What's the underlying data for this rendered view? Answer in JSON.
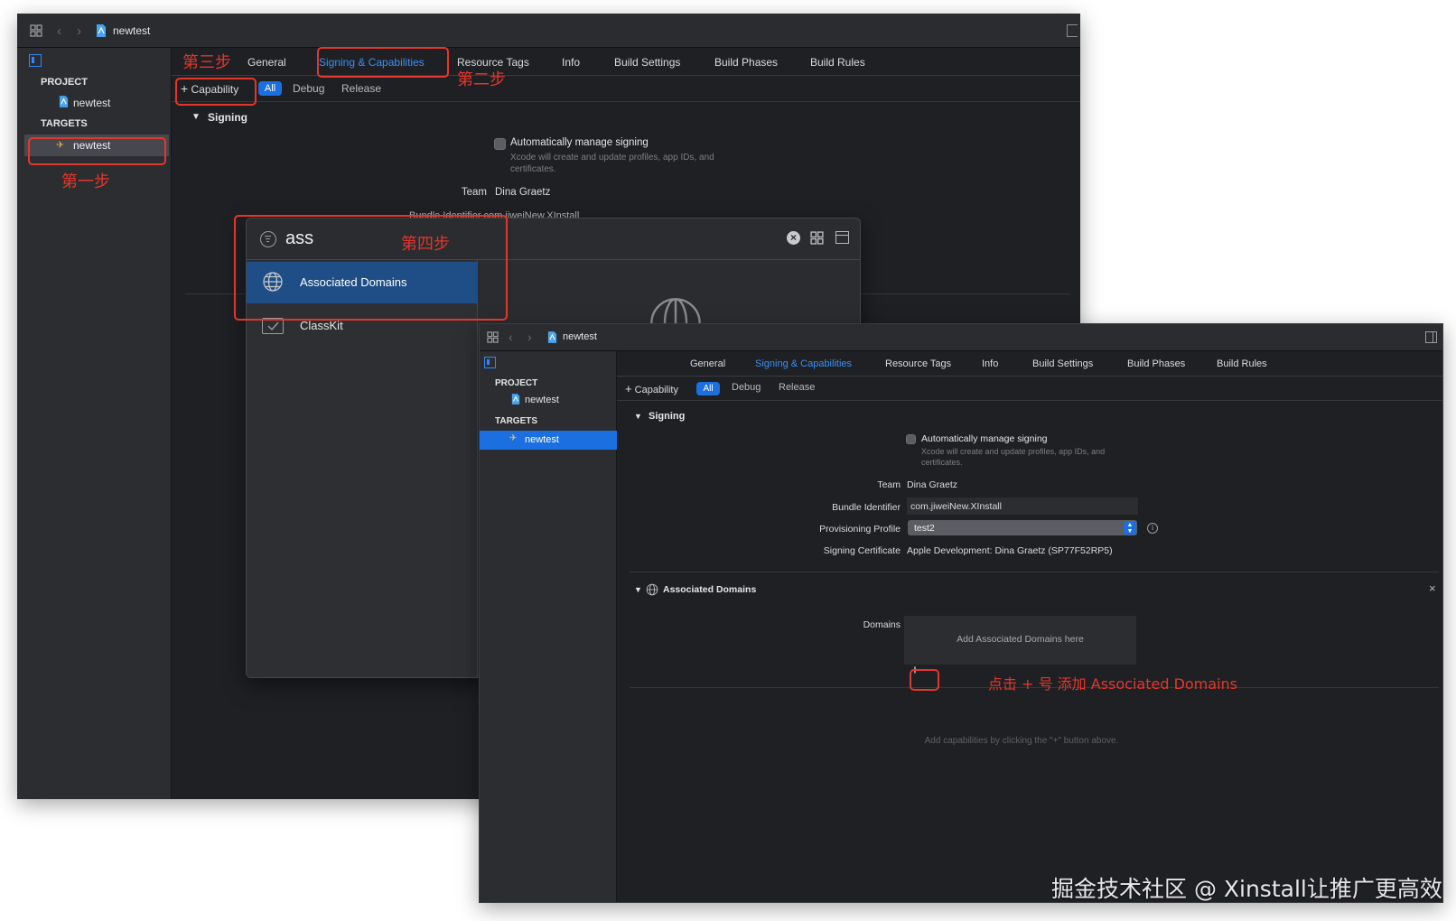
{
  "back_window": {
    "title": "newtest",
    "tabs": [
      "General",
      "Signing & Capabilities",
      "Resource Tags",
      "Info",
      "Build Settings",
      "Build Phases",
      "Build Rules"
    ],
    "active_tab": "Signing & Capabilities",
    "capability_button": "Capability",
    "filters": [
      "All",
      "Debug",
      "Release"
    ],
    "sidebar": {
      "project_header": "PROJECT",
      "project_item": "newtest",
      "targets_header": "TARGETS",
      "target_item": "newtest"
    },
    "signing": {
      "header": "Signing",
      "auto_label": "Automatically manage signing",
      "auto_desc_line1": "Xcode will create and update profiles, app IDs, and",
      "auto_desc_line2": "certificates.",
      "team_label": "Team",
      "team_value": "Dina Graetz",
      "bundle_partial": "Bundle Identifier  com.jiweiNew.XInstall"
    },
    "popup": {
      "search_value": "ass",
      "results": [
        "Associated Domains",
        "ClassKit"
      ]
    }
  },
  "front_window": {
    "title": "newtest",
    "tabs": [
      "General",
      "Signing & Capabilities",
      "Resource Tags",
      "Info",
      "Build Settings",
      "Build Phases",
      "Build Rules"
    ],
    "active_tab": "Signing & Capabilities",
    "capability_button": "Capability",
    "filters": [
      "All",
      "Debug",
      "Release"
    ],
    "sidebar": {
      "project_header": "PROJECT",
      "project_item": "newtest",
      "targets_header": "TARGETS",
      "target_item": "newtest"
    },
    "signing": {
      "header": "Signing",
      "auto_label": "Automatically manage signing",
      "auto_desc_line1": "Xcode will create and update profiles, app IDs, and",
      "auto_desc_line2": "certificates.",
      "team_label": "Team",
      "team_value": "Dina Graetz",
      "bundle_label": "Bundle Identifier",
      "bundle_value": "com.jiweiNew.XInstall",
      "profile_label": "Provisioning Profile",
      "profile_value": "test2",
      "cert_label": "Signing Certificate",
      "cert_value": "Apple Development: Dina Graetz (SP77F52RP5)"
    },
    "associated_domains": {
      "header": "Associated Domains",
      "domains_label": "Domains",
      "placeholder": "Add Associated Domains here",
      "add_symbol": "+",
      "remove_symbol": "—",
      "close_symbol": "×"
    },
    "empty_hint": "Add capabilities by clicking the \"+\" button above."
  },
  "annotations": {
    "step1": "第一步",
    "step2": "第二步",
    "step3": "第三步",
    "step4": "第四步",
    "add_note": "点击 + 号 添加 Associated Domains"
  },
  "watermark": "掘金技术社区 @ Xinstall让推广更高效",
  "colors": {
    "annotation_red": "#e4372b",
    "accent_blue": "#3d8ff5",
    "selection_blue": "#1b6fe0"
  }
}
